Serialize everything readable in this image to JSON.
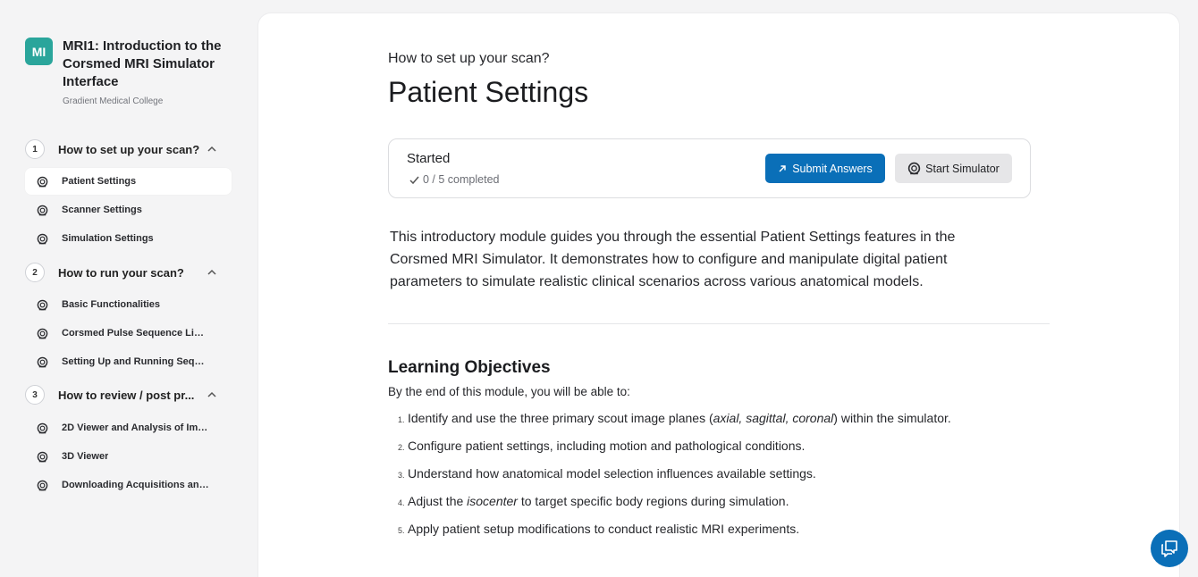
{
  "course": {
    "avatar_initials": "MI",
    "avatar_color": "#2aa59b",
    "title": "MRI1: Introduction to the Corsmed MRI Simulator Interface",
    "organization": "Gradient Medical College"
  },
  "sidebar": {
    "sections": [
      {
        "number": "1",
        "label": "How to set up your scan?",
        "lessons": [
          "Patient Settings",
          "Scanner Settings",
          "Simulation Settings"
        ]
      },
      {
        "number": "2",
        "label": "How to run your scan?",
        "lessons": [
          "Basic Functionalities",
          "Corsmed Pulse Sequence Libr...",
          "Setting Up and Running Seque..."
        ]
      },
      {
        "number": "3",
        "label": "How to review / post pr...",
        "lessons": [
          "2D Viewer and Analysis of Ima...",
          "3D Viewer",
          "Downloading Acquisitions and ..."
        ]
      }
    ],
    "active_lesson": "Patient Settings"
  },
  "main": {
    "eyebrow": "How to set up your scan?",
    "title": "Patient Settings",
    "status": {
      "label": "Started",
      "progress": "0 / 5 completed",
      "submit_label": "Submit Answers",
      "simulator_label": "Start Simulator"
    },
    "intro": "This introductory module guides you through the essential Patient Settings features in the Corsmed MRI Simulator. It demonstrates how to configure and manipulate digital patient parameters to simulate realistic clinical scenarios across various anatomical models.",
    "objectives": {
      "heading": "Learning Objectives",
      "subheading": "By the end of this module, you will be able to:",
      "items": [
        {
          "num": "1.",
          "pre": "Identify and use the three primary scout image planes (",
          "em": "axial, sagittal, coronal",
          "post": ") within the simulator."
        },
        {
          "num": "2.",
          "pre": "Configure patient settings, including motion and pathological conditions.",
          "em": "",
          "post": ""
        },
        {
          "num": "3.",
          "pre": "Understand how anatomical model selection influences available settings.",
          "em": "",
          "post": ""
        },
        {
          "num": "4.",
          "pre": "Adjust the ",
          "em": "isocenter",
          "post": " to target specific body regions during simulation."
        },
        {
          "num": "5.",
          "pre": "Apply patient setup modifications to conduct realistic MRI experiments.",
          "em": "",
          "post": ""
        }
      ]
    }
  },
  "colors": {
    "primary": "#0a6fb8",
    "background": "#f4f4f5",
    "panel": "#ffffff"
  }
}
